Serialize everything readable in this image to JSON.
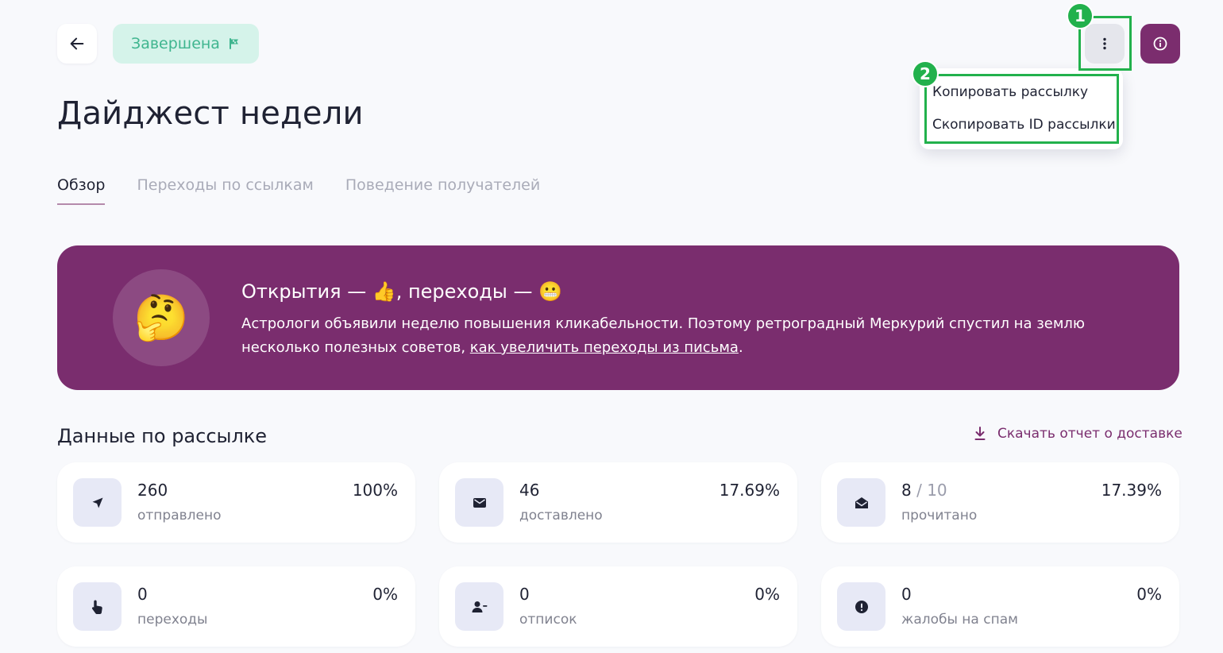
{
  "header": {
    "status_label": "Завершена",
    "status_color": "#3fb58f",
    "accent_color": "#7a2d6e"
  },
  "annotations": {
    "badge_1": "1",
    "badge_2": "2"
  },
  "menu": {
    "items": [
      "Копировать рассылку",
      "Скопировать ID рассылки"
    ]
  },
  "page": {
    "title": "Дайджест недели"
  },
  "tabs": [
    {
      "label": "Обзор",
      "active": true
    },
    {
      "label": "Переходы по ссылкам",
      "active": false
    },
    {
      "label": "Поведение получателей",
      "active": false
    }
  ],
  "banner": {
    "emoji": "🤔",
    "title": "Открытия — 👍, переходы — 😬",
    "text_before_link": "Астрологи объявили неделю повышения кликабельности. Поэтому ретроградный Меркурий спустил на землю несколько полезных советов, ",
    "link_text": "как увеличить переходы из письма",
    "text_after_link": "."
  },
  "section": {
    "title": "Данные по рассылке",
    "download_label": "Скачать отчет о доставке"
  },
  "stats": [
    {
      "value": "260",
      "secondary": "",
      "label": "отправлено",
      "percent": "100%",
      "icon": "send-icon"
    },
    {
      "value": "46",
      "secondary": "",
      "label": "доставлено",
      "percent": "17.69%",
      "icon": "mail-icon"
    },
    {
      "value": "8",
      "secondary": " / 10",
      "label": "прочитано",
      "percent": "17.39%",
      "icon": "mail-open-icon"
    },
    {
      "value": "0",
      "secondary": "",
      "label": "переходы",
      "percent": "0%",
      "icon": "pointer-icon"
    },
    {
      "value": "0",
      "secondary": "",
      "label": "отписок",
      "percent": "0%",
      "icon": "user-minus-icon"
    },
    {
      "value": "0",
      "secondary": "",
      "label": "жалобы на спам",
      "percent": "0%",
      "icon": "alert-icon"
    }
  ]
}
